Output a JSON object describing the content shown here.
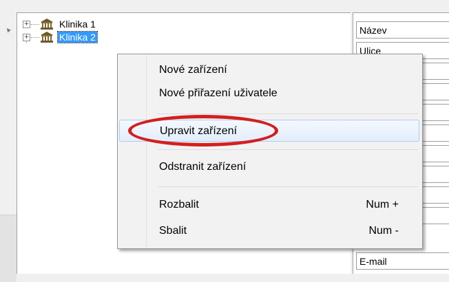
{
  "tree": {
    "nodes": [
      {
        "label": "Klinika 1",
        "expander": "+",
        "icon": "bank-icon",
        "selected": false
      },
      {
        "label": "Klinika 2",
        "expander": "+",
        "icon": "bank-icon",
        "selected": true
      }
    ]
  },
  "property_grid": {
    "fields": [
      "Název",
      "Ulice",
      "",
      "",
      "",
      "",
      "",
      "",
      "",
      "",
      "E-mail"
    ]
  },
  "context_menu": {
    "items": [
      {
        "label": "Nové zařízení",
        "shortcut": ""
      },
      {
        "label": "Nové přiřazení uživatele",
        "shortcut": ""
      },
      {
        "label": "Upravit zařízení",
        "shortcut": "",
        "highlighted": true
      },
      {
        "label": "Odstranit zařízení",
        "shortcut": ""
      },
      {
        "label": "Rozbalit",
        "shortcut": "Num +"
      },
      {
        "label": "Sbalit",
        "shortcut": "Num -"
      }
    ]
  },
  "colors": {
    "selection": "#3399ff",
    "annotation_oval": "#d31f1f",
    "menu_background": "#f2f2f2"
  }
}
